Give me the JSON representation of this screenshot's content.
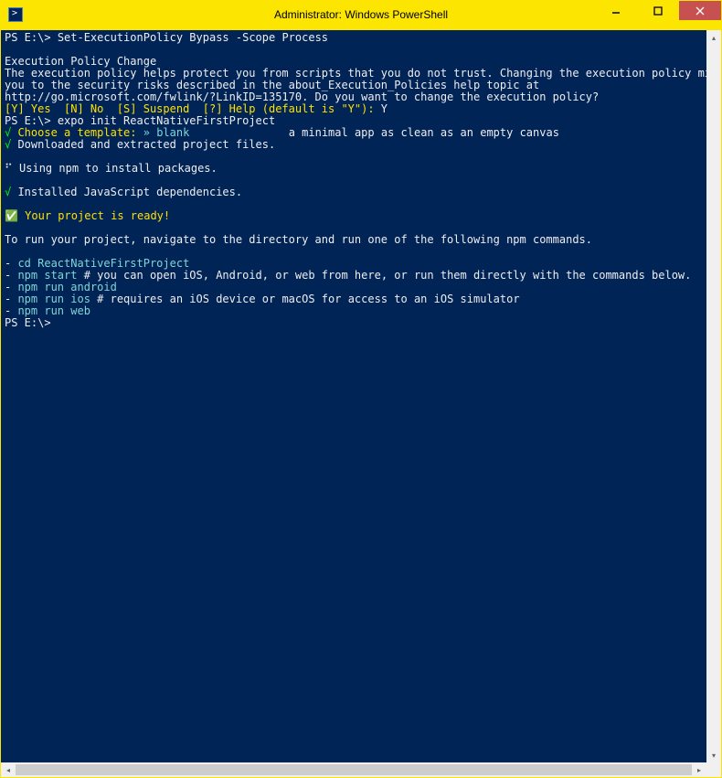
{
  "window": {
    "title": "Administrator: Windows PowerShell",
    "min_tip": "Minimize",
    "max_tip": "Maximize",
    "close_tip": "Close"
  },
  "term": {
    "prompt": "PS E:\\>",
    "cmd1": "Set-ExecutionPolicy Bypass -Scope Process",
    "blank0": "",
    "policy_hdr": "Execution Policy Change",
    "policy_l1": "The execution policy helps protect you from scripts that you do not trust. Changing the execution policy mig",
    "policy_l2": "you to the security risks described in the about_Execution_Policies help topic at",
    "policy_l3": "http://go.microsoft.com/fwlink/?LinkID=135170. Do you want to change the execution policy?",
    "policy_opts": "[Y] Yes  [N] No  [S] Suspend  [?] Help (default is \"Y\"):",
    "policy_ans": " Y",
    "cmd2": "expo init ReactNativeFirstProject",
    "check": "√",
    "choose_tpl": " Choose a template: ",
    "arrow": "»",
    "tpl_name": " blank",
    "tpl_gap": "               ",
    "tpl_desc": "a minimal app as clean as an empty canvas",
    "downloaded": " Downloaded and extracted project files.",
    "blank1": "",
    "using_npm": " Using npm to install packages.",
    "blank2": "",
    "installed": " Installed JavaScript dependencies.",
    "blank3": "",
    "ready_icon": "✅",
    "ready": " Your project is ready!",
    "blank4": "",
    "torun": "To run your project, navigate to the directory and run one of the following npm commands.",
    "blank5": "",
    "dash": "-",
    "cd": " cd ReactNativeFirstProject",
    "npm_start": " npm start",
    "npm_start_rest": " # you can open iOS, Android, or web from here, or run them directly with the commands below.",
    "npm_android": " npm run android",
    "npm_ios": " npm run ios",
    "npm_ios_rest": " # requires an iOS device or macOS for access to an iOS simulator",
    "npm_web": " npm run web",
    "final_prompt": "PS E:\\>"
  },
  "icons": {
    "chev_up": "▴",
    "chev_down": "▾",
    "chev_left": "◂",
    "chev_right": "▸"
  }
}
